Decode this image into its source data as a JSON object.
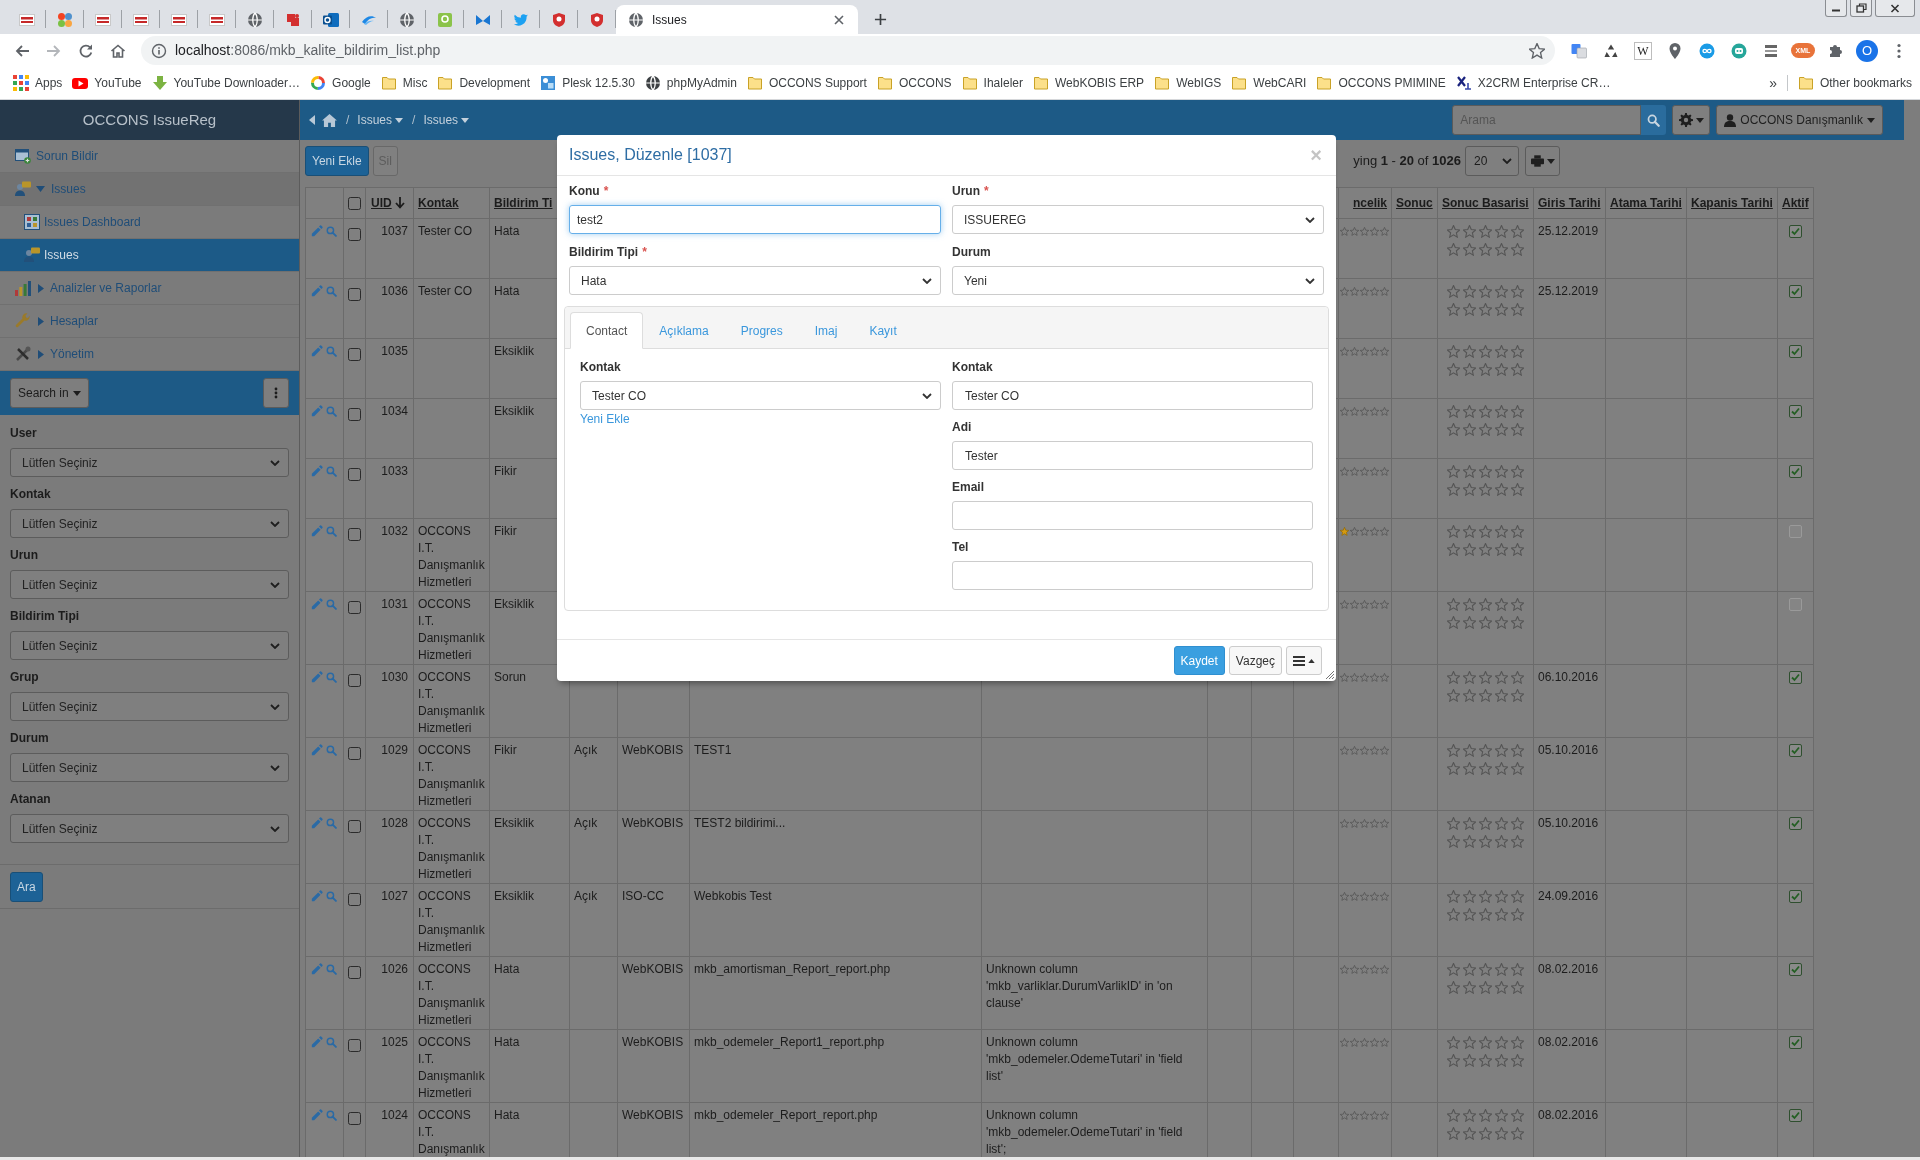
{
  "browser": {
    "tabs": [
      {
        "kind": "occons",
        "selected": false
      },
      {
        "kind": "joomla",
        "selected": false
      },
      {
        "kind": "occons",
        "selected": false
      },
      {
        "kind": "occons",
        "selected": false
      },
      {
        "kind": "occons",
        "selected": false
      },
      {
        "kind": "occons",
        "selected": false
      },
      {
        "kind": "globe",
        "selected": false
      },
      {
        "kind": "redapp",
        "selected": false
      },
      {
        "kind": "outlook",
        "selected": false
      },
      {
        "kind": "swoosh",
        "selected": false
      },
      {
        "kind": "globe",
        "selected": false
      },
      {
        "kind": "green",
        "selected": false
      },
      {
        "kind": "bluem",
        "selected": false
      },
      {
        "kind": "twitter",
        "selected": false
      },
      {
        "kind": "shield",
        "selected": false
      },
      {
        "kind": "shield",
        "selected": false
      },
      {
        "kind": "globe",
        "title": "Issues",
        "selected": true
      }
    ],
    "url": {
      "host": "localhost",
      "rest": ":8086/mkb_kalite_bildirim_list.php"
    },
    "extensions": [
      {
        "kind": "translate"
      },
      {
        "kind": "recycle"
      },
      {
        "kind": "wiki",
        "label": "W"
      },
      {
        "kind": "pin"
      },
      {
        "kind": "infinity"
      },
      {
        "kind": "robot"
      },
      {
        "kind": "tools"
      },
      {
        "kind": "xml",
        "label": "XML"
      },
      {
        "kind": "puzzle"
      }
    ],
    "profile": "O",
    "bookmarks": [
      {
        "kind": "apps",
        "label": "Apps"
      },
      {
        "kind": "youtube",
        "label": "YouTube"
      },
      {
        "kind": "download",
        "label": "YouTube Downloader…"
      },
      {
        "kind": "google",
        "label": "Google"
      },
      {
        "kind": "folder",
        "label": "Misc"
      },
      {
        "kind": "folder",
        "label": "Development"
      },
      {
        "kind": "plesk",
        "label": "Plesk 12.5.30"
      },
      {
        "kind": "globe",
        "label": "phpMyAdmin"
      },
      {
        "kind": "folder",
        "label": "OCCONS Support"
      },
      {
        "kind": "folder",
        "label": "OCCONS"
      },
      {
        "kind": "folder",
        "label": "Ihaleler"
      },
      {
        "kind": "folder",
        "label": "WebKOBIS ERP"
      },
      {
        "kind": "folder",
        "label": "WebIGS"
      },
      {
        "kind": "folder",
        "label": "WebCARI"
      },
      {
        "kind": "folder",
        "label": "OCCONS PMIMINE"
      },
      {
        "kind": "x2crm",
        "label": "X2CRM Enterprise CR…"
      }
    ],
    "bookmarks_overflow": "»",
    "other_bookmarks": "Other bookmarks"
  },
  "app": {
    "sidebar": {
      "title": "OCCONS IssueReg",
      "menu": [
        {
          "kind": "report",
          "label": "Sorun Bildir",
          "selected": false
        },
        {
          "kind": "issues",
          "label": "Issues",
          "selected": false,
          "expanded": true,
          "children": [
            {
              "kind": "dashboard",
              "label": "Issues Dashboard",
              "selected": false
            },
            {
              "kind": "issues",
              "label": "Issues",
              "selected": true
            }
          ]
        },
        {
          "kind": "chart",
          "label": "Analizler ve Raporlar",
          "selected": false,
          "expanded": false
        },
        {
          "kind": "wrench",
          "label": "Hesaplar",
          "selected": false,
          "expanded": false
        },
        {
          "kind": "tools",
          "label": "Yönetim",
          "selected": false,
          "expanded": false
        }
      ],
      "search_in": "Search in",
      "filters": [
        {
          "label": "User",
          "placeholder": "Lütfen Seçiniz"
        },
        {
          "label": "Kontak",
          "placeholder": "Lütfen Seçiniz"
        },
        {
          "label": "Urun",
          "placeholder": "Lütfen Seçiniz"
        },
        {
          "label": "Bildirim Tipi",
          "placeholder": "Lütfen Seçiniz"
        },
        {
          "label": "Grup",
          "placeholder": "Lütfen Seçiniz"
        },
        {
          "label": "Durum",
          "placeholder": "Lütfen Seçiniz"
        },
        {
          "label": "Atanan",
          "placeholder": "Lütfen Seçiniz"
        }
      ],
      "search_button": "Ara"
    },
    "navbar": {
      "breadcrumbs": [
        {
          "separator": "/",
          "label": "Issues"
        },
        {
          "separator": "/",
          "label": "Issues"
        }
      ],
      "search_placeholder": "Arama",
      "user": "OCCONS Danışmanlık"
    },
    "toolbar": {
      "add": "Yeni Ekle",
      "delete": "Sil",
      "delete_disabled": true,
      "paging": "ying **1** - **20** of **1026**",
      "page_size": "20"
    },
    "table": {
      "headers": {
        "uid": {
          "label": "UID",
          "sort_descending": true
        },
        "kontak": {
          "label": "Kontak"
        },
        "bildirim_tipi": {
          "label": "Bildirim Ti"
        },
        "oncelik": {
          "label": "ncelik"
        },
        "sonuc": {
          "label": "Sonuc"
        },
        "sonuc_basarisi": {
          "label": "Sonuc Basarisi"
        },
        "giris_tarihi": {
          "label": "Giris Tarihi"
        },
        "atama_tarihi": {
          "label": "Atama Tarihi"
        },
        "kapanis_tarihi": {
          "label": "Kapanis Tarihi"
        },
        "aktif": {
          "label": "Aktif"
        }
      },
      "select_all_checked": false,
      "rows": [
        {
          "uid": "1037",
          "checked": false,
          "kontak": "Tester CO",
          "bildirim_tipi": "Hata",
          "oncelik": {
            "stars": 0
          },
          "sonuc_basarisi": {
            "stars": 0
          },
          "giris_tarihi": "25.12.2019",
          "aktif": true
        },
        {
          "uid": "1036",
          "checked": false,
          "kontak": "Tester CO",
          "bildirim_tipi": "Hata",
          "oncelik": {
            "stars": 0
          },
          "sonuc_basarisi": {
            "stars": 0
          },
          "giris_tarihi": "25.12.2019",
          "aktif": true
        },
        {
          "uid": "1035",
          "checked": false,
          "bildirim_tipi": "Eksiklik",
          "oncelik": {
            "stars": 0
          },
          "sonuc_basarisi": {
            "stars": 0
          },
          "aktif": true
        },
        {
          "uid": "1034",
          "checked": false,
          "bildirim_tipi": "Eksiklik",
          "oncelik": {
            "stars": 0
          },
          "sonuc_basarisi": {
            "stars": 0
          },
          "aktif": true
        },
        {
          "uid": "1033",
          "checked": false,
          "bildirim_tipi": "Fikir",
          "oncelik": {
            "stars": 0
          },
          "sonuc_basarisi": {
            "stars": 0
          },
          "aktif": true
        },
        {
          "uid": "1032",
          "checked": false,
          "kontak": "OCCONS I.T. Danışmanlık Hizmetleri",
          "bildirim_tipi": "Fikir",
          "oncelik": {
            "stars": 1
          },
          "sonuc_basarisi": {
            "stars": 0
          },
          "aktif": false
        },
        {
          "uid": "1031",
          "checked": false,
          "kontak": "OCCONS I.T. Danışmanlık Hizmetleri",
          "bildirim_tipi": "Eksiklik",
          "oncelik": {
            "stars": 0
          },
          "sonuc_basarisi": {
            "stars": 0
          },
          "aktif": false
        },
        {
          "uid": "1030",
          "checked": false,
          "kontak": "OCCONS I.T. Danışmanlık Hizmetleri",
          "bildirim_tipi": "Sorun",
          "oncelik": {
            "stars": 0
          },
          "sonuc_basarisi": {
            "stars": 0
          },
          "giris_tarihi": "06.10.2016",
          "aktif": true
        },
        {
          "uid": "1029",
          "checked": false,
          "kontak": "OCCONS I.T. Danışmanlık Hizmetleri",
          "bildirim_tipi": "Fikir",
          "column_6": "Açık",
          "column_7": "WebKOBIS",
          "column_8": "TEST1",
          "oncelik": {
            "stars": 0
          },
          "sonuc_basarisi": {
            "stars": 0
          },
          "giris_tarihi": "05.10.2016",
          "aktif": true
        },
        {
          "uid": "1028",
          "checked": false,
          "kontak": "OCCONS I.T. Danışmanlık Hizmetleri",
          "bildirim_tipi": "Eksiklik",
          "column_6": "Açık",
          "column_7": "WebKOBIS",
          "column_8": "TEST2 bildirimi...",
          "oncelik": {
            "stars": 0
          },
          "sonuc_basarisi": {
            "stars": 0
          },
          "giris_tarihi": "05.10.2016",
          "aktif": true
        },
        {
          "uid": "1027",
          "checked": false,
          "kontak": "OCCONS I.T. Danışmanlık Hizmetleri",
          "bildirim_tipi": "Eksiklik",
          "column_6": "Açık",
          "column_7": "ISO-CC",
          "column_8": "Webkobis Test",
          "oncelik": {
            "stars": 0
          },
          "sonuc_basarisi": {
            "stars": 0
          },
          "giris_tarihi": "24.09.2016",
          "aktif": true
        },
        {
          "uid": "1026",
          "checked": false,
          "kontak": "OCCONS I.T. Danışmanlık Hizmetleri",
          "bildirim_tipi": "Hata",
          "column_7": "WebKOBIS",
          "column_8": "mkb_amortisman_Report_report.php",
          "column_9": "Unknown column 'mkb_varliklar.DurumVarlikID' in 'on clause'",
          "oncelik": {
            "stars": 0
          },
          "sonuc_basarisi": {
            "stars": 0
          },
          "giris_tarihi": "08.02.2016",
          "aktif": true
        },
        {
          "uid": "1025",
          "checked": false,
          "kontak": "OCCONS I.T. Danışmanlık Hizmetleri",
          "bildirim_tipi": "Hata",
          "column_7": "WebKOBIS",
          "column_8": "mkb_odemeler_Report1_report.php",
          "column_9": "Unknown column 'mkb_odemeler.OdemeTutari' in 'field list'",
          "oncelik": {
            "stars": 0
          },
          "sonuc_basarisi": {
            "stars": 0
          },
          "giris_tarihi": "08.02.2016",
          "aktif": true
        },
        {
          "uid": "1024",
          "checked": false,
          "kontak": "OCCONS I.T. Danışmanlık",
          "bildirim_tipi": "Hata",
          "column_7": "WebKOBIS",
          "column_8": "mkb_odemeler_Report_report.php",
          "column_9": "Unknown column 'mkb_odemeler.OdemeTutari' in 'field list';",
          "oncelik": {
            "stars": 0
          },
          "sonuc_basarisi": {
            "stars": 0
          },
          "giris_tarihi": "08.02.2016",
          "aktif": true
        }
      ]
    },
    "modal": {
      "title": "Issues, Düzenle [1037]",
      "close": "×",
      "fields": [
        {
          "label": "Konu",
          "required_mark": "*",
          "kind": "input",
          "value": "test2",
          "focused": true
        },
        {
          "label": "Urun",
          "required_mark": "*",
          "kind": "select",
          "value": "ISSUEREG",
          "focused": false
        },
        {
          "label": "Bildirim Tipi",
          "required_mark": "*",
          "kind": "select",
          "value": "Hata",
          "focused": false
        },
        {
          "label": "Durum",
          "kind": "select",
          "value": "Yeni",
          "focused": false
        }
      ],
      "tabs": [
        {
          "label": "Contact",
          "selected": true
        },
        {
          "label": "Açıklama",
          "selected": false
        },
        {
          "label": "Progres",
          "selected": false
        },
        {
          "label": "Imaj",
          "selected": false
        },
        {
          "label": "Kayıt",
          "selected": false
        }
      ],
      "contact_select": {
        "label": "Kontak",
        "value": "Tester CO",
        "link": "Yeni Ekle"
      },
      "contact_fields": [
        {
          "label": "Kontak",
          "value": "Tester CO"
        },
        {
          "label": "Adi",
          "value": "Tester"
        },
        {
          "label": "Email"
        },
        {
          "label": "Tel"
        }
      ],
      "save": "Kaydet",
      "cancel": "Vazgeç"
    }
  }
}
